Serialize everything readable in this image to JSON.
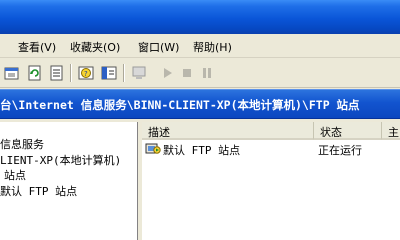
{
  "menu": {
    "view": "查看(V)",
    "favorites": "收藏夹(O)",
    "window": "窗口(W)",
    "help": "帮助(H)"
  },
  "toolbar": {
    "icons": [
      "properties-icon",
      "refresh-icon",
      "export-list-icon",
      "help-icon",
      "show-hide-tree-icon",
      "computer-icon",
      "play-icon",
      "stop-icon",
      "pause-icon"
    ]
  },
  "path": {
    "text": "台\\Internet 信息服务\\BINN-CLIENT-XP(本地计算机)\\FTP 站点"
  },
  "tree": {
    "items": [
      "信息服务",
      "LIENT-XP(本地计算机)",
      "站点",
      "默认 FTP 站点"
    ]
  },
  "list": {
    "columns": [
      "描述",
      "状态",
      "主"
    ],
    "rows": [
      {
        "description": "默认 FTP 站点",
        "status": "正在运行"
      }
    ]
  },
  "colors": {
    "title_blue": "#0a55d8",
    "path_blue": "#1254cf",
    "face": "#ece9d8"
  }
}
